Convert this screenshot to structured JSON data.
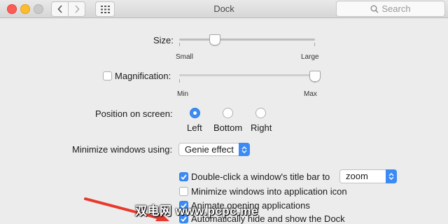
{
  "window": {
    "title": "Dock",
    "search_placeholder": "Search"
  },
  "size": {
    "label": "Size:",
    "min_label": "Small",
    "max_label": "Large",
    "value_fraction": 0.26
  },
  "magnification": {
    "label": "Magnification:",
    "checked": false,
    "min_label": "Min",
    "max_label": "Max",
    "value_fraction": 1.0
  },
  "position": {
    "label": "Position on screen:",
    "options": [
      "Left",
      "Bottom",
      "Right"
    ],
    "selected": "Left"
  },
  "minimize": {
    "label": "Minimize windows using:",
    "value": "Genie effect"
  },
  "options": [
    {
      "label": "Double-click a window's title bar to",
      "checked": true
    },
    {
      "label": "Minimize windows into application icon",
      "checked": false
    },
    {
      "label": "Animate opening applications",
      "checked": true
    },
    {
      "label": "Automatically hide and show the Dock",
      "checked": true
    }
  ],
  "double_click_action": "zoom",
  "watermark": "双电网 www.pcpc.me",
  "accent_color": "#3b8bf5"
}
